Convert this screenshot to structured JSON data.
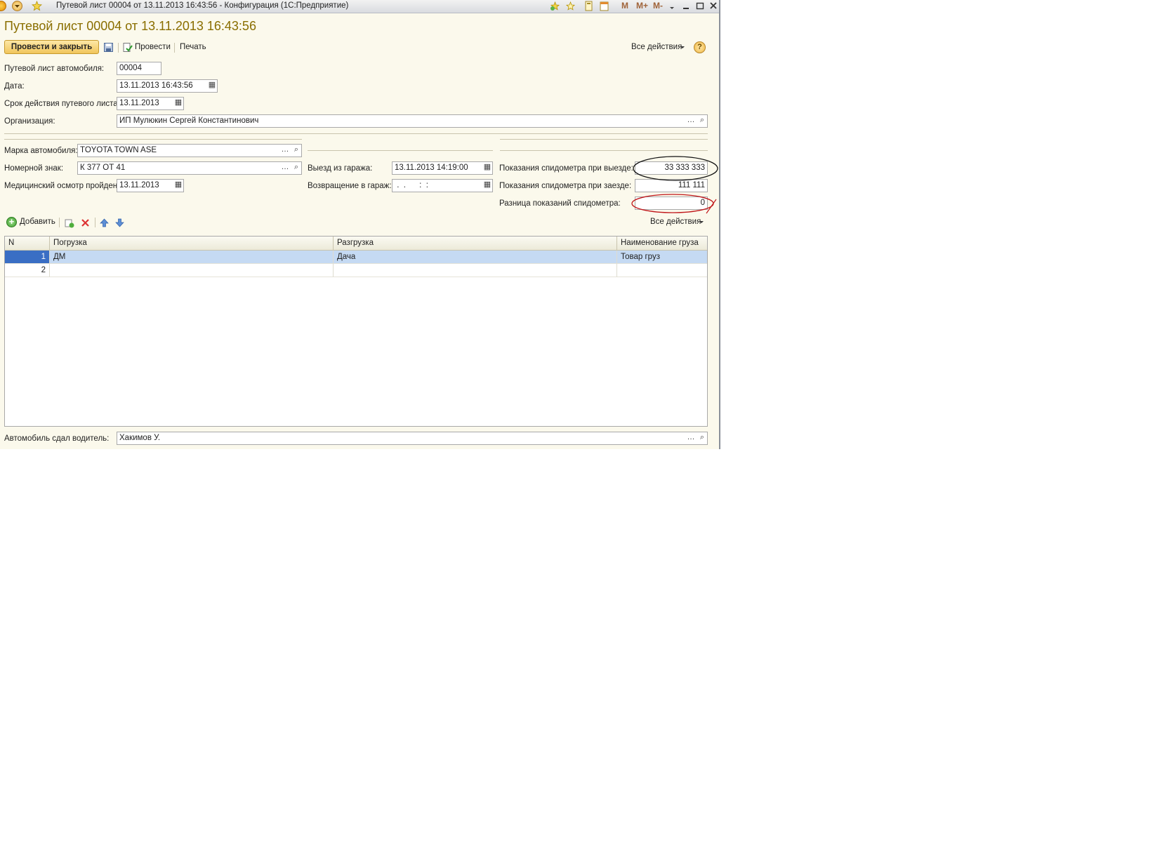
{
  "window": {
    "title": "Путевой лист 00004 от 13.11.2013 16:43:56 - Конфигурация (1С:Предприятие)",
    "mem_buttons": [
      "M",
      "M+",
      "M-"
    ]
  },
  "form": {
    "heading": "Путевой лист 00004 от 13.11.2013 16:43:56",
    "toolbar": {
      "post_close": "Провести и закрыть",
      "post": "Провести",
      "print": "Печать",
      "all_actions": "Все действия"
    },
    "fields": {
      "waybill_label": "Путевой лист автомобиля:",
      "waybill_value": "00004",
      "date_label": "Дата:",
      "date_value": "13.11.2013 16:43:56",
      "validity_label": "Срок действия путевого листа:",
      "validity_value": "13.11.2013",
      "org_label": "Организация:",
      "org_value": "ИП Мулюкин Сергей Константинович",
      "brand_label": "Марка автомобиля:",
      "brand_value": "TOYOTA TOWN ASE",
      "plate_label": "Номерной знак:",
      "plate_value": "К 377 ОТ 41",
      "medical_label": "Медицинский осмотр пройден:",
      "medical_value": "13.11.2013",
      "departure_label": "Выезд из гаража:",
      "departure_value": "13.11.2013 14:19:00",
      "return_label": "Возвращение в гараж:",
      "return_value": " .  .      :  :",
      "odo_out_label": "Показания спидометра при выезде:",
      "odo_out_value": "33 333 333",
      "odo_in_label": "Показания спидометра при заезде:",
      "odo_in_value": "111 111",
      "odo_diff_label": "Разница показаний спидометра:",
      "odo_diff_value": "0",
      "driver_label": "Автомобиль сдал водитель:",
      "driver_value": "Хакимов У."
    },
    "table_toolbar": {
      "add": "Добавить",
      "all_actions": "Все действия"
    },
    "table": {
      "columns": [
        "N",
        "Погрузка",
        "Разгрузка",
        "Наименование груза"
      ],
      "rows": [
        {
          "n": "1",
          "load": "ДМ",
          "unload": "Дача",
          "cargo": "Товар груз"
        },
        {
          "n": "2",
          "load": "",
          "unload": "",
          "cargo": ""
        }
      ]
    }
  }
}
